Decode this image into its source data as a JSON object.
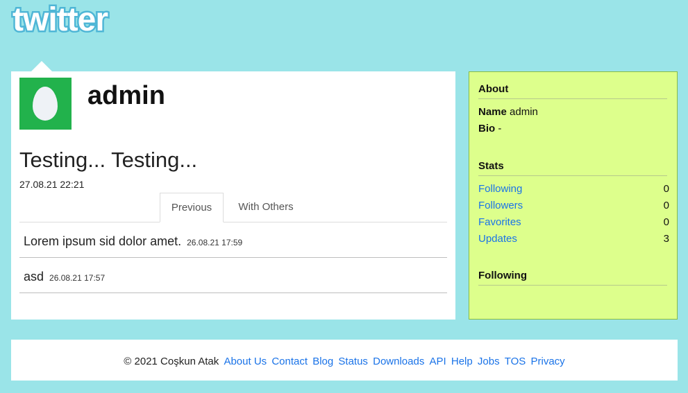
{
  "brand": {
    "logo_text": "twitter"
  },
  "profile": {
    "username": "admin",
    "status": "Testing... Testing...",
    "status_time": "27.08.21 22:21"
  },
  "tabs": [
    {
      "label": "Previous",
      "active": true
    },
    {
      "label": "With Others",
      "active": false
    }
  ],
  "feed": [
    {
      "text": "Lorem ipsum sid dolor amet.",
      "time": "26.08.21 17:59"
    },
    {
      "text": "asd",
      "time": "26.08.21 17:57"
    }
  ],
  "sidebar": {
    "about_heading": "About",
    "name_label": "Name",
    "name_value": "admin",
    "bio_label": "Bio",
    "bio_value": "-",
    "stats_heading": "Stats",
    "stats": [
      {
        "label": "Following",
        "value": "0"
      },
      {
        "label": "Followers",
        "value": "0"
      },
      {
        "label": "Favorites",
        "value": "0"
      },
      {
        "label": "Updates",
        "value": "3"
      }
    ],
    "following_heading": "Following"
  },
  "footer": {
    "copyright": "© 2021 Coşkun Atak",
    "links": [
      "About Us",
      "Contact",
      "Blog",
      "Status",
      "Downloads",
      "API",
      "Help",
      "Jobs",
      "TOS",
      "Privacy"
    ]
  },
  "colors": {
    "background": "#9ae4e8",
    "sidebar_bg": "#ddff8c",
    "sidebar_border": "#87bc44",
    "link": "#1a73e8",
    "avatar_bg": "#22b24c"
  }
}
